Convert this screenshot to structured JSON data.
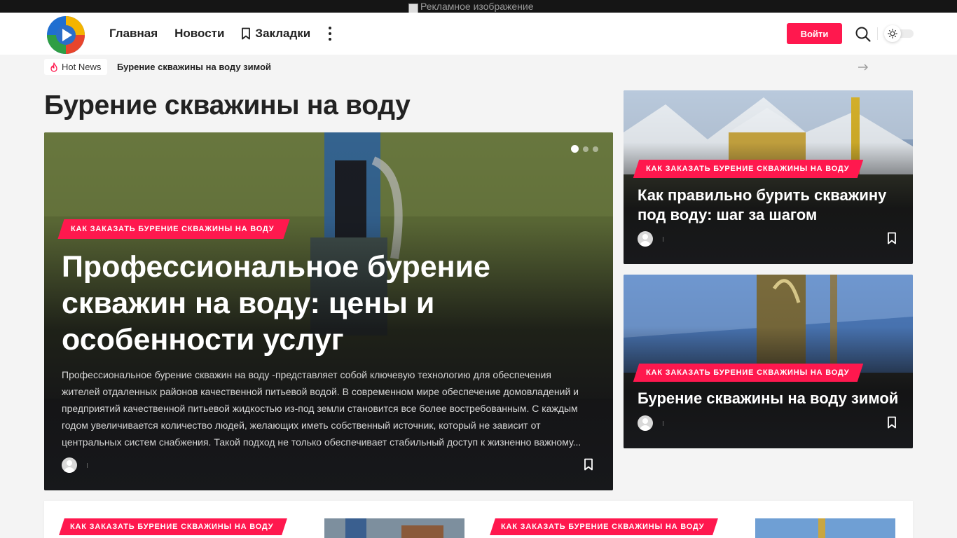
{
  "ad": {
    "alt": "Рекламное изображение"
  },
  "header": {
    "nav": [
      {
        "label": "Главная"
      },
      {
        "label": "Новости"
      },
      {
        "label": "Закладки"
      }
    ],
    "login_label": "Войти",
    "accent_color": "#ff184e"
  },
  "hotnews": {
    "badge": "Hot News",
    "title": "Бурение скважины на воду зимой"
  },
  "page": {
    "title": "Бурение скважины на воду"
  },
  "featured": {
    "category": "КАК ЗАКАЗАТЬ БУРЕНИЕ СКВАЖИНЫ НА ВОДУ",
    "title": "Профессиональное бурение скважин на воду: цены и особенности услуг",
    "excerpt": "Профессиональное бурение скважин на воду  -представляет собой ключевую технологию для обеспечения жителей отдаленных районов качественной питьевой водой. В современном мире обеспечение домовладений и предприятий качественной питьевой жидкостью из-под земли становится все более востребованным. С каждым годом увеличивается количество людей, желающих иметь собственный источник, который не зависит от центральных систем снабжения. Такой подход не только обеспечивает стабильный доступ к жизненно важному...",
    "slides_total": 3,
    "slide_active": 1
  },
  "side_posts": [
    {
      "category": "КАК ЗАКАЗАТЬ БУРЕНИЕ СКВАЖИНЫ НА ВОДУ",
      "title": "Как правильно бурить скважину под воду: шаг за шагом"
    },
    {
      "category": "КАК ЗАКАЗАТЬ БУРЕНИЕ СКВАЖИНЫ НА ВОДУ",
      "title": "Бурение скважины на воду зимой"
    }
  ],
  "bottom_posts": [
    {
      "category": "КАК ЗАКАЗАТЬ БУРЕНИЕ СКВАЖИНЫ НА ВОДУ"
    },
    {
      "category": "КАК ЗАКАЗАТЬ БУРЕНИЕ СКВАЖИНЫ НА ВОДУ"
    }
  ]
}
